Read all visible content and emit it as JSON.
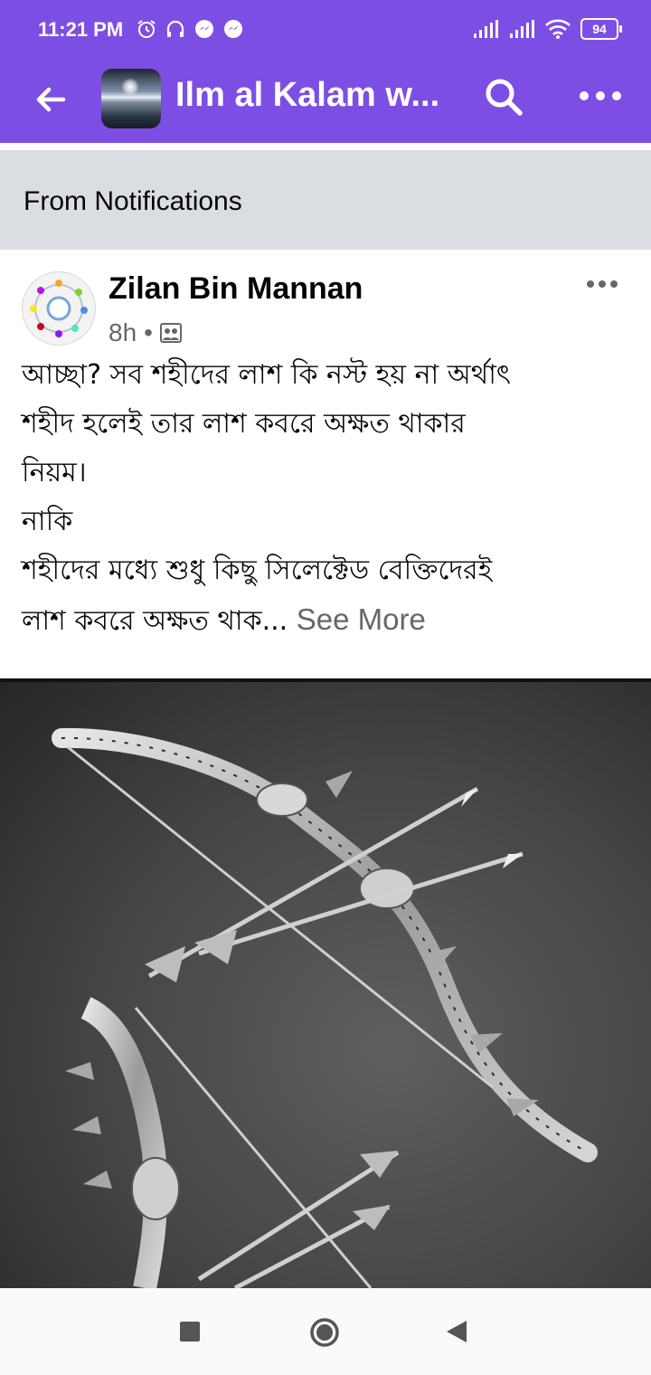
{
  "status_bar": {
    "time": "11:21 PM",
    "left_icons": [
      "alarm-icon",
      "headphones-icon",
      "messenger-icon",
      "messenger-icon"
    ],
    "right_icons": [
      "signal-icon",
      "signal-icon",
      "wifi-icon"
    ],
    "battery": "94"
  },
  "app_bar": {
    "title": "Ilm al Kalam w...",
    "background_color": "#7d4ee4",
    "icons": [
      "back-arrow-icon",
      "search-icon",
      "more-horizontal-icon"
    ]
  },
  "notification_banner": {
    "text": "From Notifications"
  },
  "post": {
    "author": "Zilan Bin Mannan",
    "time": "8h",
    "separator": "•",
    "audience_icon": "group-audience-icon",
    "body_lines": [
      "আচ্ছা? সব শহীদের লাশ কি নস্ট হয় না অর্থাৎ",
      "শহীদ হলেই তার লাশ কবরে অক্ষত থাকার",
      "নিয়ম।",
      "নাকি",
      "শহীদের মধ্যে শুধু কিছু সিলেক্টেড বেক্তিদেরই"
    ],
    "body_last_line": "লাশ কবরে অক্ষত থাক...",
    "see_more": "See More",
    "image_icon": "bows-and-arrows-image"
  },
  "nav_bar": {
    "icons": [
      "recents-square-icon",
      "home-circle-icon",
      "back-triangle-icon"
    ]
  }
}
